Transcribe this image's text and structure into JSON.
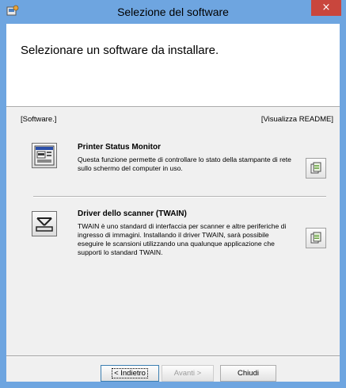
{
  "window": {
    "title": "Selezione del software",
    "close_label": "×"
  },
  "header": {
    "heading": "Selezionare un software da installare."
  },
  "list": {
    "software_label": "[Software.]",
    "readme_label": "[Visualizza README]"
  },
  "items": [
    {
      "title": "Printer Status Monitor",
      "description": "Questa funzione permette di controllare lo stato della stampante di rete sullo schermo del computer in uso.",
      "icon": "printer-status-monitor-icon"
    },
    {
      "title": "Driver dello scanner (TWAIN)",
      "description": "TWAIN è uno standard di interfaccia per scanner e altre periferiche di ingresso di immagini. Installando il driver TWAIN, sarà possibile eseguire le scansioni utilizzando una qualunque applicazione che supporti lo standard TWAIN.",
      "icon": "scanner-icon"
    }
  ],
  "buttons": {
    "back": "< Indietro",
    "next": "Avanti >",
    "close": "Chiudi"
  }
}
